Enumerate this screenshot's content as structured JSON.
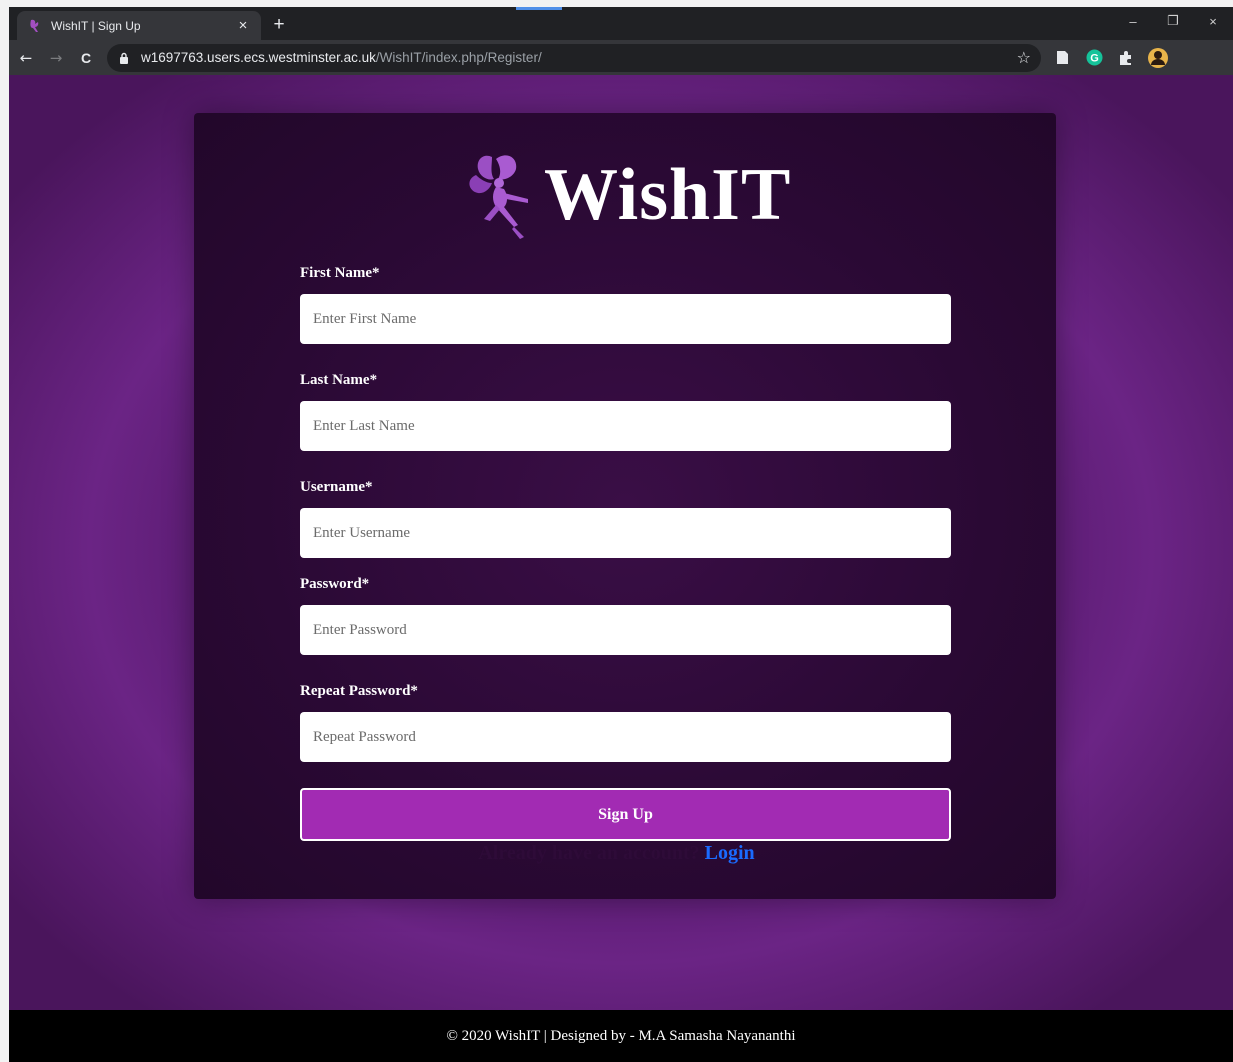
{
  "browser": {
    "tab_title": "WishIT | Sign Up",
    "tab_close": "×",
    "new_tab": "+",
    "url_host": "w1697763.users.ecs.westminster.ac.uk",
    "url_path": "/WishIT/index.php/Register/",
    "back": "←",
    "forward": "→",
    "reload": "C",
    "star": "☆",
    "minimize": "–",
    "restore": "❐",
    "close": "×"
  },
  "logo": {
    "text": "WishIT"
  },
  "form": {
    "fields": [
      {
        "label": "First Name*",
        "placeholder": "Enter First Name"
      },
      {
        "label": "Last Name*",
        "placeholder": "Enter Last Name"
      },
      {
        "label": "Username*",
        "placeholder": "Enter Username"
      },
      {
        "label": "Password*",
        "placeholder": "Enter Password"
      },
      {
        "label": "Repeat Password*",
        "placeholder": "Repeat Password"
      }
    ],
    "submit_label": "Sign Up"
  },
  "account_prompt": {
    "text": "Already have an account?",
    "link": "Login"
  },
  "footer": {
    "text": "© 2020 WishIT | Designed by - M.A Samasha Nayananthi"
  },
  "colors": {
    "accent": "#a22bb3",
    "link": "#1a6bff",
    "background": "#54196a",
    "card": "#2a0934"
  }
}
